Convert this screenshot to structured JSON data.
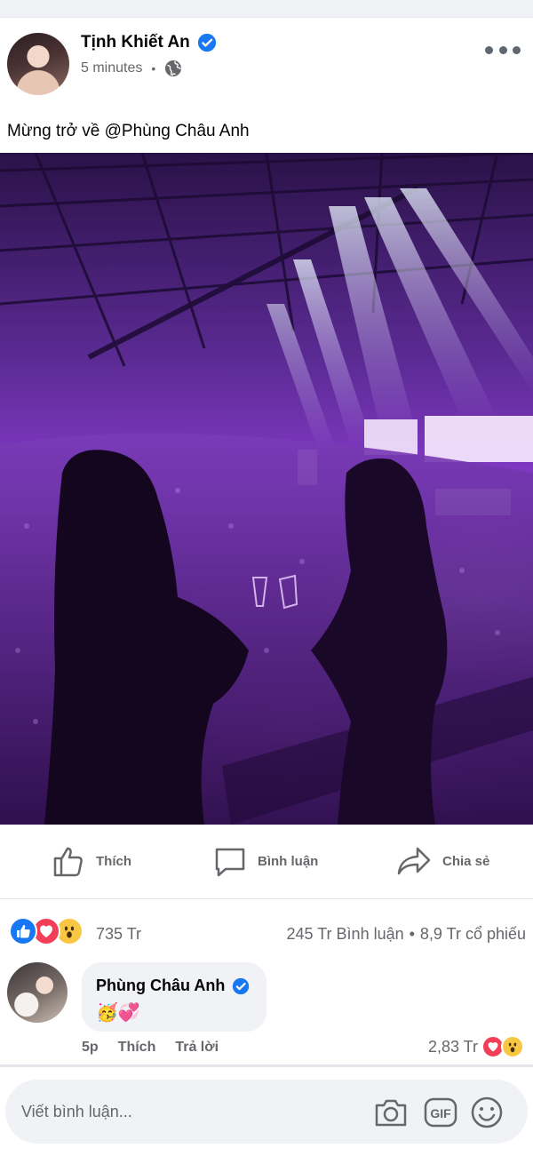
{
  "post": {
    "author": "Tịnh Khiết An",
    "timestamp": "5 minutes",
    "separator": "•",
    "privacy_icon": "globe-icon",
    "caption": "Mừng trở về @Phùng Châu Anh"
  },
  "actions": {
    "like": "Thích",
    "comment": "Bình luận",
    "share": "Chia sẻ"
  },
  "reactions": {
    "icons": [
      "like-icon",
      "love-icon",
      "wow-icon"
    ],
    "total": "735 Tr",
    "comments": "245 Tr Bình luận",
    "separator": "•",
    "shares": "8,9 Tr cổ phiếu"
  },
  "comment": {
    "author": "Phùng Châu Anh",
    "text": "🥳💞",
    "time": "5p",
    "like": "Thích",
    "reply": "Trả lời",
    "reaction_count": "2,83 Tr"
  },
  "composer": {
    "placeholder": "Viết bình luận..."
  },
  "colors": {
    "brand_blue": "#1877f2",
    "love_red": "#f33e58",
    "wow_yellow": "#f7c744",
    "muted_text": "#65676b",
    "bubble_bg": "#f0f2f5"
  }
}
